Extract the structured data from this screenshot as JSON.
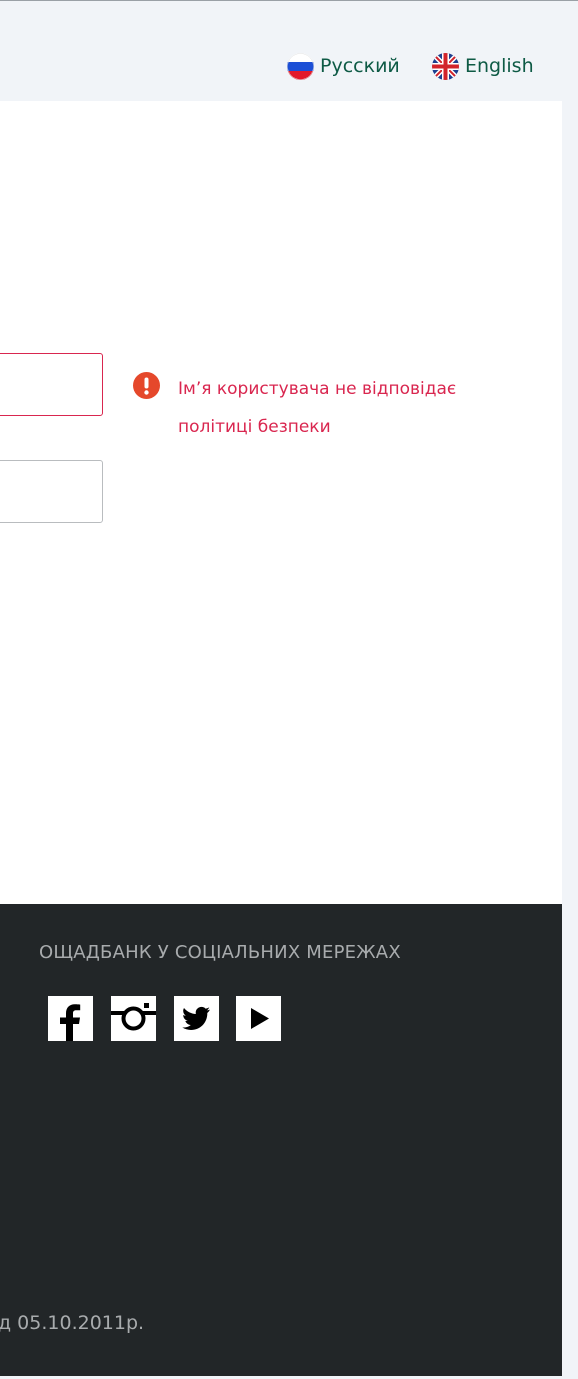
{
  "languages": [
    {
      "label": "Русский",
      "icon": "russia-flag-icon"
    },
    {
      "label": "English",
      "icon": "uk-flag-icon"
    }
  ],
  "login_form": {
    "username_value": "",
    "password_value": "",
    "error_icon": "exclamation-circle-icon",
    "error_message": "Ім’я користувача не відповідає політиці безпеки"
  },
  "footer": {
    "social_title": "ОЩАДБАНК У СОЦІАЛЬНИХ МЕРЕЖАХ",
    "social_links": [
      {
        "icon": "facebook-icon"
      },
      {
        "icon": "instagram-icon"
      },
      {
        "icon": "twitter-icon"
      },
      {
        "icon": "youtube-icon"
      }
    ],
    "license_note": "д 05.10.2011р."
  },
  "colors": {
    "error": "#d9264f",
    "link": "#0e5a45",
    "footer_bg": "#222628",
    "page_bg": "#f1f4f8"
  }
}
